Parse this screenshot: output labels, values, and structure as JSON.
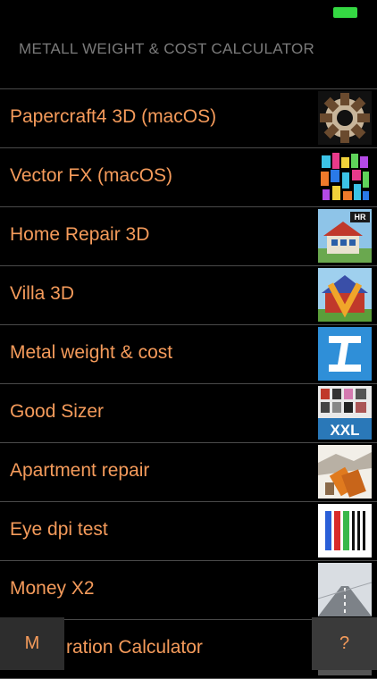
{
  "header": {
    "title": "METALL WEIGHT & COST CALCULATOR"
  },
  "apps": [
    {
      "label": "Papercraft4 3D (macOS)",
      "icon": "gear-papercraft-icon"
    },
    {
      "label": "Vector FX (macOS)",
      "icon": "vector-fx-icon"
    },
    {
      "label": "Home Repair 3D",
      "icon": "house-hr-icon"
    },
    {
      "label": "Villa 3D",
      "icon": "villa-icon"
    },
    {
      "label": "Metal weight & cost",
      "icon": "i-beam-icon"
    },
    {
      "label": "Good Sizer",
      "icon": "xxl-sizer-icon"
    },
    {
      "label": "Apartment repair",
      "icon": "apartment-repair-icon"
    },
    {
      "label": "Eye dpi test",
      "icon": "dpi-test-icon"
    },
    {
      "label": "Money X2",
      "icon": "road-icon"
    },
    {
      "label": "ration Calculator",
      "icon": "calculator-icon"
    }
  ],
  "buttons": {
    "left_label": "M",
    "right_label": "?"
  },
  "colors": {
    "accent": "#f59b5b",
    "battery": "#35d943",
    "background": "#000000"
  }
}
